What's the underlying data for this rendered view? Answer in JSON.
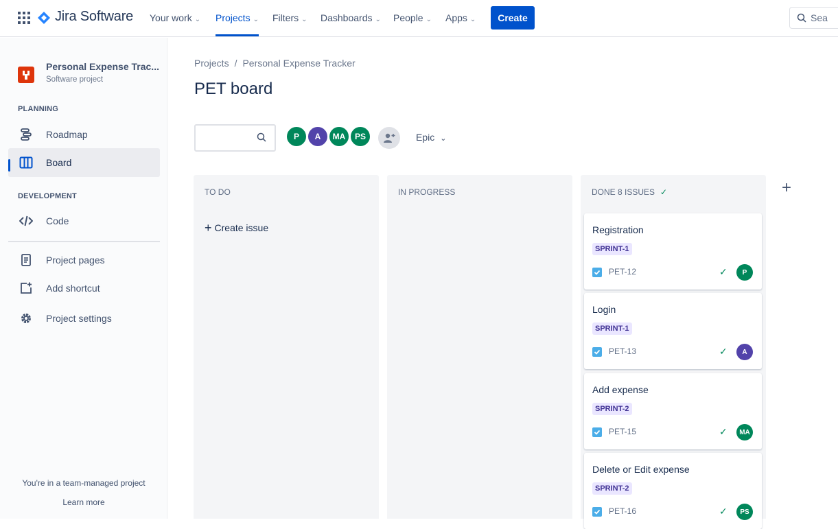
{
  "topnav": {
    "product": "Jira Software",
    "items": [
      {
        "label": "Your work",
        "chevron": "⌄"
      },
      {
        "label": "Projects",
        "chevron": "⌄"
      },
      {
        "label": "Filters",
        "chevron": "⌄"
      },
      {
        "label": "Dashboards",
        "chevron": "⌄"
      },
      {
        "label": "People",
        "chevron": "⌄"
      },
      {
        "label": "Apps",
        "chevron": "⌄"
      }
    ],
    "create_label": "Create",
    "search_placeholder": "Sea"
  },
  "sidebar": {
    "project_name": "Personal Expense Trac...",
    "project_type": "Software project",
    "planning_label": "PLANNING",
    "development_label": "DEVELOPMENT",
    "items": [
      {
        "label": "Roadmap",
        "icon": "roadmap-icon"
      },
      {
        "label": "Board",
        "icon": "board-icon"
      },
      {
        "label": "Code",
        "icon": "code-icon"
      },
      {
        "label": "Project pages",
        "icon": "page-icon"
      },
      {
        "label": "Add shortcut",
        "icon": "add-shortcut-icon"
      },
      {
        "label": "Project settings",
        "icon": "gear-icon"
      }
    ],
    "footer_text": "You're in a team-managed project",
    "footer_link": "Learn more"
  },
  "main": {
    "breadcrumb": [
      "Projects",
      "/",
      "Personal Expense Tracker"
    ],
    "title": "PET board",
    "avatars": [
      "P",
      "A",
      "MA",
      "PS"
    ],
    "epic_filter": "Epic",
    "epic_chevron": "⌄",
    "add_column": "+"
  },
  "columns": [
    {
      "title": "TO DO",
      "create_issue": "Create issue"
    },
    {
      "title": "IN PROGRESS"
    },
    {
      "title": "DONE 8 ISSUES",
      "check": "✓"
    }
  ],
  "cards": [
    {
      "title": "Registration",
      "label": "SPRINT-1",
      "key": "PET-12",
      "assignee": "P",
      "color": "#00875a",
      "done": "✓"
    },
    {
      "title": "Login",
      "label": "SPRINT-1",
      "key": "PET-13",
      "assignee": "A",
      "color": "#5243aa",
      "done": "✓"
    },
    {
      "title": "Add expense",
      "label": "SPRINT-2",
      "key": "PET-15",
      "assignee": "MA",
      "color": "#00875a",
      "done": "✓"
    },
    {
      "title": "Delete or Edit expense",
      "label": "SPRINT-2",
      "key": "PET-16",
      "assignee": "PS",
      "color": "#00875a",
      "done": "✓"
    }
  ]
}
